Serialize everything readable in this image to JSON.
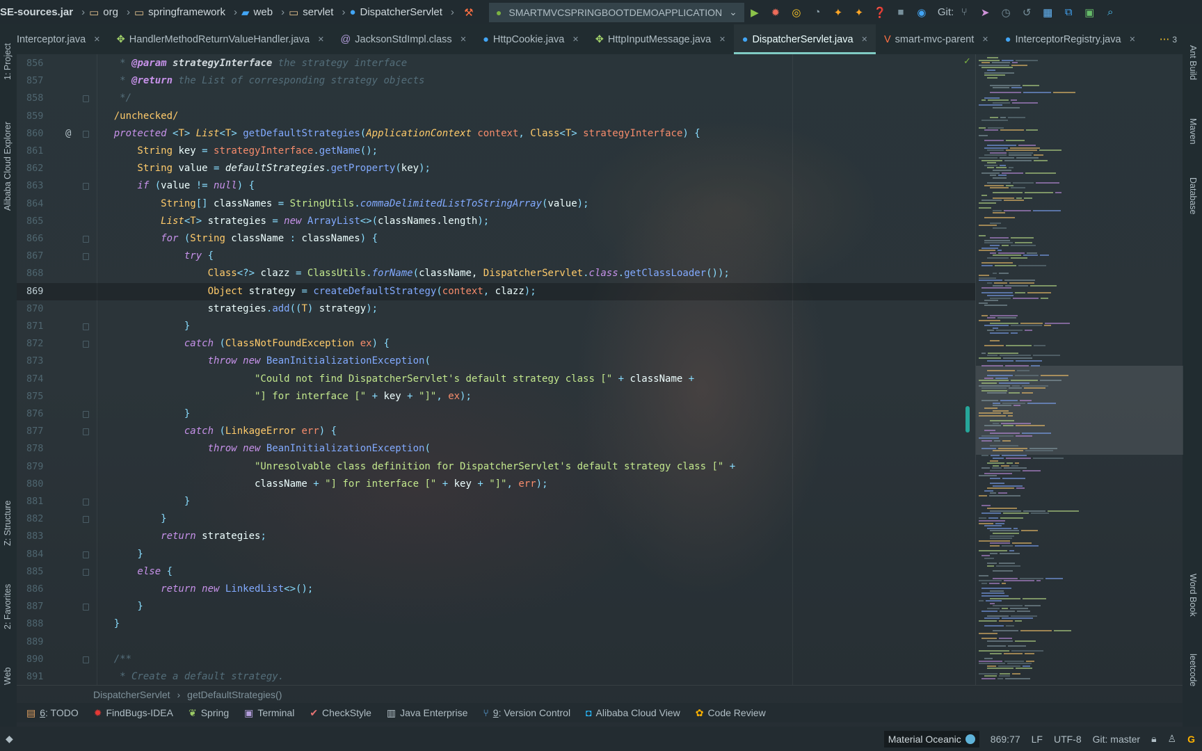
{
  "breadcrumb": [
    {
      "label": "SE-sources.jar",
      "icon": "jar-icon"
    },
    {
      "label": "org",
      "icon": "folder-icon"
    },
    {
      "label": "springframework",
      "icon": "folder-icon"
    },
    {
      "label": "web",
      "icon": "web-folder-icon"
    },
    {
      "label": "servlet",
      "icon": "folder-icon"
    },
    {
      "label": "DispatcherServlet",
      "icon": "class-icon"
    }
  ],
  "run_config": "SMARTMVCSPRINGBOOTDEMOAPPLICATION",
  "git_label": "Git:",
  "tabs": [
    {
      "label": "Interceptor.java",
      "icon": "interface-icon",
      "active": false
    },
    {
      "label": "HandlerMethodReturnValueHandler.java",
      "icon": "interface-icon",
      "active": false
    },
    {
      "label": "JacksonStdImpl.class",
      "icon": "annotation-icon",
      "active": false
    },
    {
      "label": "HttpCookie.java",
      "icon": "class-icon",
      "active": false
    },
    {
      "label": "HttpInputMessage.java",
      "icon": "interface-icon",
      "active": false
    },
    {
      "label": "DispatcherServlet.java",
      "icon": "class-icon",
      "active": true
    },
    {
      "label": "smart-mvc-parent",
      "icon": "maven-icon",
      "active": false
    },
    {
      "label": "InterceptorRegistry.java",
      "icon": "class-icon",
      "active": false
    }
  ],
  "tabs_overflow": "3",
  "left_stripe": [
    "1: Project",
    "Alibaba Cloud Explorer",
    "Z: Structure",
    "2: Favorites",
    "Web"
  ],
  "right_stripe": [
    "Ant Build",
    "Maven",
    "Database",
    "Word Book",
    "leetcode"
  ],
  "current_line": 869,
  "code": [
    {
      "n": 856,
      "t": [
        [
          "c",
          "     * "
        ],
        [
          "ct",
          "@param"
        ],
        [
          "cp",
          " strategyInterface"
        ],
        [
          "c",
          " the strategy interface"
        ]
      ]
    },
    {
      "n": 857,
      "t": [
        [
          "c",
          "     * "
        ],
        [
          "ct",
          "@return"
        ],
        [
          "c",
          " the List of corresponding strategy objects"
        ]
      ]
    },
    {
      "n": 858,
      "fold": true,
      "t": [
        [
          "c",
          "     */"
        ]
      ]
    },
    {
      "n": 859,
      "t": [
        [
          "an",
          "    /unchecked/"
        ]
      ]
    },
    {
      "n": 860,
      "gutter": "@",
      "fold": true,
      "t": [
        [
          "kw",
          "    protected "
        ],
        [
          "p",
          "<"
        ],
        [
          "ty",
          "T"
        ],
        [
          "p",
          "> "
        ],
        [
          "tyi",
          "List"
        ],
        [
          "p",
          "<"
        ],
        [
          "ty",
          "T"
        ],
        [
          "p",
          "> "
        ],
        [
          "fn",
          "getDefaultStrategies"
        ],
        [
          "p",
          "("
        ],
        [
          "tyi",
          "ApplicationContext"
        ],
        [
          "fd",
          " context"
        ],
        [
          "p",
          ", "
        ],
        [
          "ty",
          "Class"
        ],
        [
          "p",
          "<"
        ],
        [
          "ty",
          "T"
        ],
        [
          "p",
          "> "
        ],
        [
          "fd",
          "strategyInterface"
        ],
        [
          "p",
          ") {"
        ]
      ]
    },
    {
      "n": 861,
      "t": [
        [
          "ty",
          "        String"
        ],
        [
          "tx",
          " key "
        ],
        [
          "p",
          "= "
        ],
        [
          "fd",
          "strategyInterface"
        ],
        [
          "p",
          "."
        ],
        [
          "fn",
          "getName"
        ],
        [
          "p",
          "();"
        ]
      ]
    },
    {
      "n": 862,
      "t": [
        [
          "ty",
          "        String"
        ],
        [
          "tx",
          " value "
        ],
        [
          "p",
          "= "
        ],
        [
          "fdi",
          "defaultStrategies"
        ],
        [
          "p",
          "."
        ],
        [
          "fn",
          "getProperty"
        ],
        [
          "p",
          "("
        ],
        [
          "tx",
          "key"
        ],
        [
          "p",
          ");"
        ]
      ]
    },
    {
      "n": 863,
      "fold": true,
      "t": [
        [
          "kw",
          "        if "
        ],
        [
          "p",
          "("
        ],
        [
          "tx",
          "value "
        ],
        [
          "p",
          "!= "
        ],
        [
          "kw",
          "null"
        ],
        [
          "p",
          ") {"
        ]
      ]
    },
    {
      "n": 864,
      "t": [
        [
          "ty",
          "            String"
        ],
        [
          "p",
          "[] "
        ],
        [
          "tx",
          "classNames "
        ],
        [
          "p",
          "= "
        ],
        [
          "st",
          "StringUtils"
        ],
        [
          "p",
          "."
        ],
        [
          "fni",
          "commaDelimitedListToStringArray"
        ],
        [
          "p",
          "("
        ],
        [
          "tx",
          "value"
        ],
        [
          "p",
          ");"
        ]
      ]
    },
    {
      "n": 865,
      "t": [
        [
          "tyi",
          "            List"
        ],
        [
          "p",
          "<"
        ],
        [
          "ty",
          "T"
        ],
        [
          "p",
          "> "
        ],
        [
          "tx",
          "strategies "
        ],
        [
          "p",
          "= "
        ],
        [
          "kw",
          "new "
        ],
        [
          "cl",
          "ArrayList"
        ],
        [
          "p",
          "<>("
        ],
        [
          "tx",
          "classNames.length"
        ],
        [
          "p",
          ");"
        ]
      ]
    },
    {
      "n": 866,
      "fold": true,
      "t": [
        [
          "kw",
          "            for "
        ],
        [
          "p",
          "("
        ],
        [
          "ty",
          "String"
        ],
        [
          "tx",
          " className "
        ],
        [
          "p",
          ": "
        ],
        [
          "tx",
          "classNames"
        ],
        [
          "p",
          ") {"
        ]
      ]
    },
    {
      "n": 867,
      "fold": true,
      "t": [
        [
          "kw",
          "                try "
        ],
        [
          "p",
          "{"
        ]
      ]
    },
    {
      "n": 868,
      "t": [
        [
          "ty",
          "                    Class"
        ],
        [
          "p",
          "<?> "
        ],
        [
          "tx",
          "clazz "
        ],
        [
          "p",
          "= "
        ],
        [
          "st",
          "ClassUtils"
        ],
        [
          "p",
          "."
        ],
        [
          "fni",
          "forName"
        ],
        [
          "p",
          "("
        ],
        [
          "tx",
          "className, "
        ],
        [
          "ty",
          "DispatcherServlet"
        ],
        [
          "p",
          "."
        ],
        [
          "kw",
          "class"
        ],
        [
          "p",
          "."
        ],
        [
          "fn",
          "getClassLoader"
        ],
        [
          "p",
          "());"
        ]
      ]
    },
    {
      "n": 869,
      "t": [
        [
          "ty",
          "                    Object"
        ],
        [
          "tx",
          " strategy "
        ],
        [
          "p",
          "= "
        ],
        [
          "fn",
          "createDefaultStrategy"
        ],
        [
          "p",
          "("
        ],
        [
          "fd",
          "context"
        ],
        [
          "p",
          ", "
        ],
        [
          "tx",
          "clazz"
        ],
        [
          "p",
          ");"
        ]
      ]
    },
    {
      "n": 870,
      "t": [
        [
          "tx",
          "                    strategies"
        ],
        [
          "p",
          "."
        ],
        [
          "fn",
          "add"
        ],
        [
          "p",
          "(("
        ],
        [
          "ty",
          "T"
        ],
        [
          "p",
          ") "
        ],
        [
          "tx",
          "strategy"
        ],
        [
          "p",
          ");"
        ]
      ]
    },
    {
      "n": 871,
      "fold": true,
      "t": [
        [
          "p",
          "                }"
        ]
      ]
    },
    {
      "n": 872,
      "fold": true,
      "t": [
        [
          "kw",
          "                catch "
        ],
        [
          "p",
          "("
        ],
        [
          "ty",
          "ClassNotFoundException"
        ],
        [
          "fd",
          " ex"
        ],
        [
          "p",
          ") {"
        ]
      ]
    },
    {
      "n": 873,
      "t": [
        [
          "kw",
          "                    throw new "
        ],
        [
          "cl",
          "BeanInitializationException"
        ],
        [
          "p",
          "("
        ]
      ]
    },
    {
      "n": 874,
      "t": [
        [
          "st",
          "                            \"Could not find DispatcherServlet's default strategy class [\""
        ],
        [
          "p",
          " + "
        ],
        [
          "tx",
          "className "
        ],
        [
          "p",
          "+"
        ]
      ]
    },
    {
      "n": 875,
      "t": [
        [
          "st",
          "                            \"] for interface [\""
        ],
        [
          "p",
          " + "
        ],
        [
          "tx",
          "key "
        ],
        [
          "p",
          "+ "
        ],
        [
          "st",
          "\"]\""
        ],
        [
          "p",
          ", "
        ],
        [
          "fd",
          "ex"
        ],
        [
          "p",
          ");"
        ]
      ]
    },
    {
      "n": 876,
      "fold": true,
      "t": [
        [
          "p",
          "                }"
        ]
      ]
    },
    {
      "n": 877,
      "fold": true,
      "t": [
        [
          "kw",
          "                catch "
        ],
        [
          "p",
          "("
        ],
        [
          "ty",
          "LinkageError"
        ],
        [
          "fd",
          " err"
        ],
        [
          "p",
          ") {"
        ]
      ]
    },
    {
      "n": 878,
      "t": [
        [
          "kw",
          "                    throw new "
        ],
        [
          "cl",
          "BeanInitializationException"
        ],
        [
          "p",
          "("
        ]
      ]
    },
    {
      "n": 879,
      "t": [
        [
          "st",
          "                            \"Unresolvable class definition for DispatcherServlet's default strategy class [\""
        ],
        [
          "p",
          " +"
        ]
      ]
    },
    {
      "n": 880,
      "t": [
        [
          "tx",
          "                            className "
        ],
        [
          "p",
          "+ "
        ],
        [
          "st",
          "\"] for interface [\""
        ],
        [
          "p",
          " + "
        ],
        [
          "tx",
          "key "
        ],
        [
          "p",
          "+ "
        ],
        [
          "st",
          "\"]\""
        ],
        [
          "p",
          ", "
        ],
        [
          "fd",
          "err"
        ],
        [
          "p",
          ");"
        ]
      ]
    },
    {
      "n": 881,
      "fold": true,
      "t": [
        [
          "p",
          "                }"
        ]
      ]
    },
    {
      "n": 882,
      "fold": true,
      "t": [
        [
          "p",
          "            }"
        ]
      ]
    },
    {
      "n": 883,
      "t": [
        [
          "kw",
          "            return "
        ],
        [
          "tx",
          "strategies"
        ],
        [
          "p",
          ";"
        ]
      ]
    },
    {
      "n": 884,
      "fold": true,
      "t": [
        [
          "p",
          "        }"
        ]
      ]
    },
    {
      "n": 885,
      "fold": true,
      "t": [
        [
          "kw",
          "        else "
        ],
        [
          "p",
          "{"
        ]
      ]
    },
    {
      "n": 886,
      "t": [
        [
          "kw",
          "            return new "
        ],
        [
          "cl",
          "LinkedList"
        ],
        [
          "p",
          "<>();"
        ]
      ]
    },
    {
      "n": 887,
      "fold": true,
      "t": [
        [
          "p",
          "        }"
        ]
      ]
    },
    {
      "n": 888,
      "t": [
        [
          "p",
          "    }"
        ]
      ]
    },
    {
      "n": 889,
      "t": []
    },
    {
      "n": 890,
      "fold": true,
      "t": [
        [
          "c",
          "    /**"
        ]
      ]
    },
    {
      "n": 891,
      "t": [
        [
          "c",
          "     * Create a default strategy."
        ]
      ]
    }
  ],
  "editor_breadcrumb": [
    "DispatcherServlet",
    "getDefaultStrategies()"
  ],
  "tool_windows": [
    {
      "num": "6",
      "label": ": TODO",
      "icon": "todo-icon",
      "color": "#e0a060"
    },
    {
      "num": "",
      "label": "FindBugs-IDEA",
      "icon": "findbugs-icon",
      "color": "#e53935"
    },
    {
      "num": "",
      "label": "Spring",
      "icon": "spring-icon",
      "color": "#9ccc65"
    },
    {
      "num": "",
      "label": "Terminal",
      "icon": "terminal-icon",
      "color": "#b39ddb"
    },
    {
      "num": "",
      "label": "CheckStyle",
      "icon": "checkstyle-icon",
      "color": "#e57373"
    },
    {
      "num": "",
      "label": "Java Enterprise",
      "icon": "java-enterprise-icon",
      "color": "#b0bec5"
    },
    {
      "num": "9",
      "label": ": Version Control",
      "icon": "version-control-icon",
      "color": "#64b5f6"
    },
    {
      "num": "",
      "label": "Alibaba Cloud View",
      "icon": "alibaba-cloud-icon",
      "color": "#29b6f6"
    },
    {
      "num": "",
      "label": "Code Review",
      "icon": "code-review-icon",
      "color": "#ffb300"
    }
  ],
  "status": {
    "theme": "Material Oceanic",
    "position": "869:77",
    "line_sep": "LF",
    "encoding": "UTF-8",
    "git": "Git: master"
  }
}
